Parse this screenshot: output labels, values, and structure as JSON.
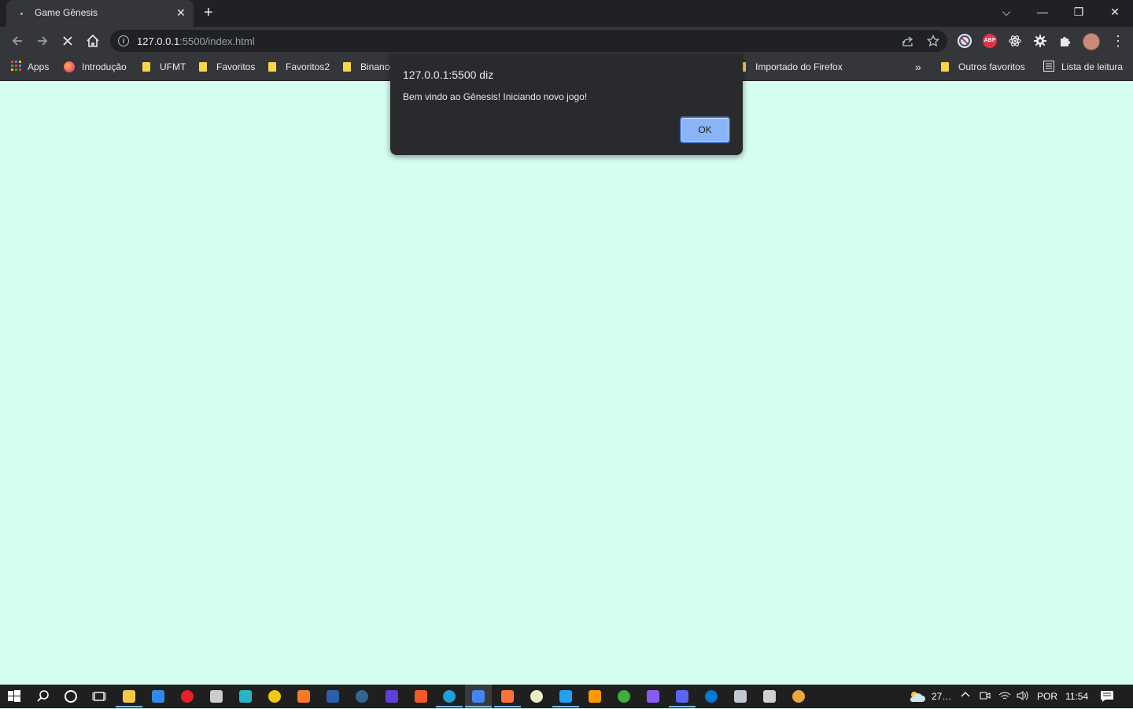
{
  "browser": {
    "tab": {
      "title": "Game Gênesis",
      "close_glyph": "✕"
    },
    "new_tab_glyph": "+",
    "window_controls": {
      "tab_search": "⌵",
      "minimize": "—",
      "restore": "❐",
      "close": "✕"
    },
    "url": {
      "host": "127.0.0.1",
      "rest": ":5500/index.html"
    },
    "info_glyph": "i",
    "extensions": [
      "block-icon",
      "adblock-plus-icon",
      "react-devtools-icon",
      "settings-gear-icon",
      "puzzle-extensions-icon",
      "profile-avatar"
    ],
    "extension_labels": {
      "abp": "ABP"
    },
    "menu_glyph": "⋮"
  },
  "bookmarks": {
    "apps": "Apps",
    "items": [
      "Introdução",
      "UFMT",
      "Favoritos",
      "Favoritos2",
      "Binance",
      "Importado do Firefox"
    ],
    "overflow": "»",
    "other": "Outros favoritos",
    "reading_list": "Lista de leitura"
  },
  "page": {
    "background": "#d4fff0"
  },
  "dialog": {
    "title": "127.0.0.1:5500 diz",
    "message": "Bem vindo ao Gênesis! Iniciando novo jogo!",
    "ok": "OK"
  },
  "taskbar": {
    "apps": [
      "windows-start-icon",
      "search-icon",
      "cortana-icon",
      "task-view-icon",
      "file-explorer-icon",
      "mail-icon",
      "app-red-icon",
      "terminal-icon",
      "git-icon",
      "sticky-notes-icon",
      "xampp-icon",
      "app-blue-icon",
      "postgres-icon",
      "app-purple-icon",
      "postman-icon",
      "edge-icon",
      "chrome-icon",
      "firefox-icon",
      "notepad-icon",
      "vscode-icon",
      "sublime-icon",
      "app-green-icon",
      "github-desktop-icon",
      "discord-icon",
      "app-store-icon",
      "app-cloud-icon",
      "app-controller-icon",
      "app-last-icon"
    ],
    "weather": "27…",
    "language": "POR",
    "time": "11:54"
  }
}
